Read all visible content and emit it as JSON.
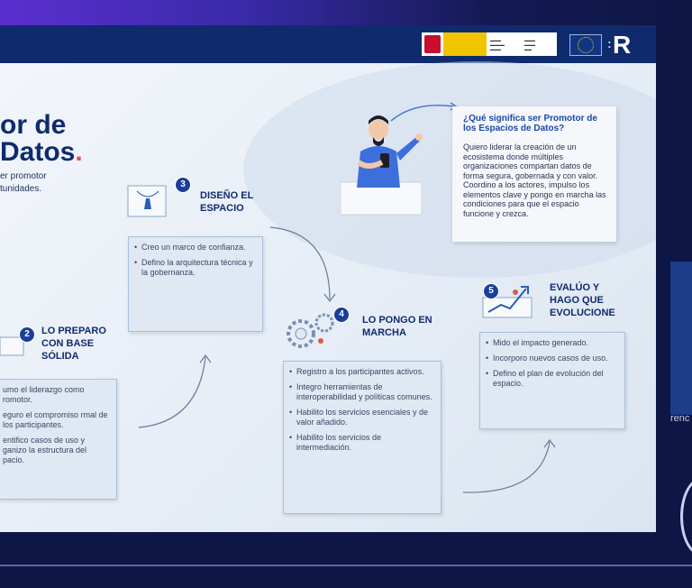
{
  "slide": {
    "title_line1": "or de",
    "title_line2": "Datos",
    "title_dot": ".",
    "subtitle_line1": "er promotor",
    "subtitle_line2": "tunidades."
  },
  "question": {
    "title": "¿Qué significa ser Promotor de los Espacios de Datos?",
    "text": "Quiero liderar la creación de un ecosistema donde múltiples organizaciones compartan datos de forma segura, gobernada y con valor. Coordino a los actores, impulso los elementos clave y pongo en marcha las condiciones para que el espacio funcione y crezca."
  },
  "steps": [
    {
      "num": "2",
      "label": "LO PREPARO CON BASE SÓLIDA",
      "items": [
        "umo el liderazgo como romotor.",
        "eguro el compromiso rmal de los participantes.",
        "entifico casos de uso y ganizo la estructura del pacio."
      ]
    },
    {
      "num": "3",
      "label": "DISEÑO EL ESPACIO",
      "items": [
        "Creo un marco de confianza.",
        "Defino la arquitectura técnica y la gobernanza."
      ]
    },
    {
      "num": "4",
      "label": "LO PONGO EN MARCHA",
      "items": [
        "Registro a los participantes activos.",
        "Integro herramientas de interoperabilidad y políticas comunes.",
        "Habilito los servicios esenciales y de valor añadido.",
        "Habilito los servicios de intermediación."
      ]
    },
    {
      "num": "5",
      "label": "EVALÚO Y HAGO QUE EVOLUCIONE",
      "items": [
        "Mido el impacto generado.",
        "Incorporo nuevos casos de uso.",
        "Defino el plan de evolución del espacio."
      ]
    }
  ],
  "side_text": "renc",
  "colors": {
    "navy": "#0f2b6e",
    "accent": "#e2574c",
    "blue": "#1a49a8"
  }
}
